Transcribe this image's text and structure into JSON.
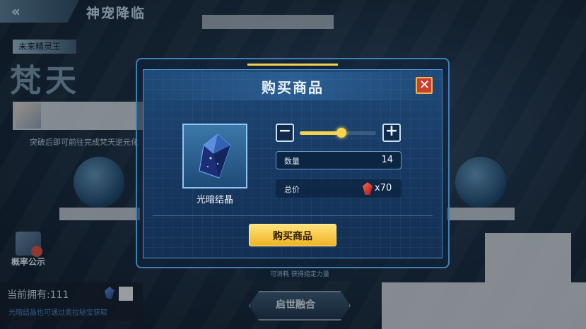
{
  "background": {
    "page_title": "神宠降临",
    "pet_tag": "未来精灵王",
    "pet_name": "梵天",
    "hint_left": "突破后即可前往完成梵天逆元化",
    "prob_label": "概率公示",
    "own_text": "当前拥有:111",
    "own_hint": "光暗结晶也可通过奥拉秘宝获取",
    "exchange_text": "可消耗   获得指定力量",
    "fusion_label": "启世融合"
  },
  "dialog": {
    "title": "购买商品",
    "item_name": "光暗结晶",
    "quantity_label": "数量",
    "quantity_value": "14",
    "total_label": "总价",
    "total_value": "x70",
    "buy_label": "购买商品",
    "slider_fraction": 0.55,
    "colors": {
      "accent": "#f4d24a",
      "close": "#c9402f",
      "button": "#f1b324"
    }
  },
  "icons": {
    "back": "double-chevron-left-icon",
    "close": "close-icon",
    "minus": "minus-icon",
    "plus": "plus-icon",
    "gem": "red-gem-icon",
    "crystal": "dark-crystal-icon"
  }
}
